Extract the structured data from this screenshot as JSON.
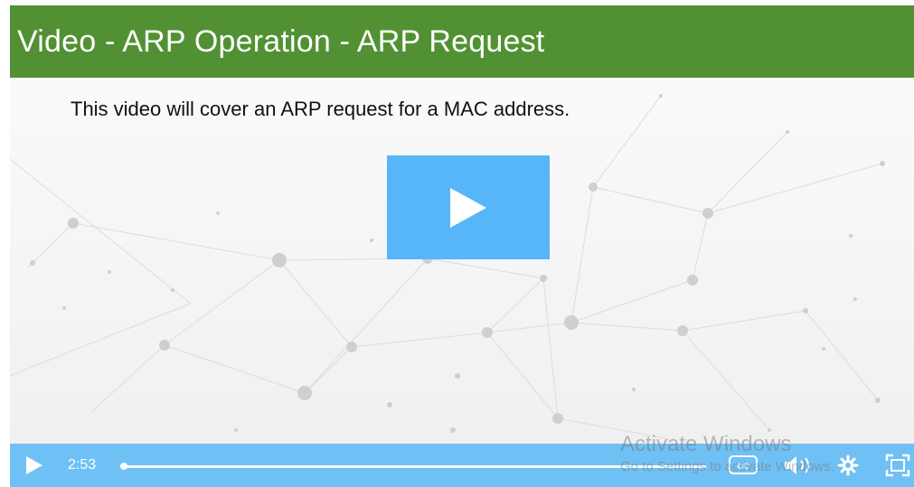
{
  "title": "Video - ARP Operation - ARP Request",
  "slide": {
    "subtitle": "This video will cover an ARP request for a MAC address."
  },
  "controls": {
    "time": "2:53",
    "cc_label": "cc"
  },
  "watermark": {
    "title": "Activate Windows",
    "subtitle": "Go to Settings to activate Windows."
  },
  "colors": {
    "title_bar": "#529133",
    "play_overlay": "#57b6f7",
    "control_bar": "#6fc0f4"
  },
  "icons": [
    "play-icon",
    "closed-captions-icon",
    "volume-icon",
    "settings-gear-icon",
    "fullscreen-icon"
  ]
}
